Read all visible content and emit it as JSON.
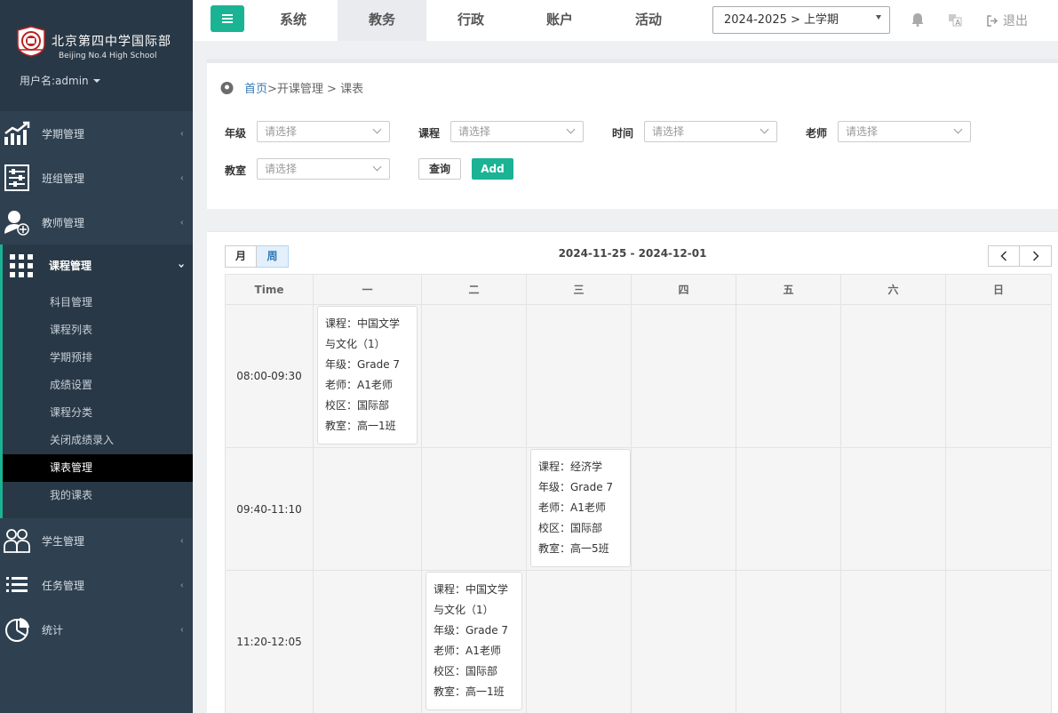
{
  "sidebar": {
    "school_cn": "北京第四中学国际部",
    "school_en": "Beijing No.4 High School",
    "user_label": "用户名:admin",
    "menu": [
      {
        "label": "学期管理",
        "icon": "chart-up-icon"
      },
      {
        "label": "班组管理",
        "icon": "sliders-icon"
      },
      {
        "label": "教师管理",
        "icon": "user-add-icon"
      },
      {
        "label": "课程管理",
        "icon": "grid-icon"
      },
      {
        "label": "学生管理",
        "icon": "users-icon"
      },
      {
        "label": "任务管理",
        "icon": "list-icon"
      },
      {
        "label": "统计",
        "icon": "pie-chart-icon"
      }
    ],
    "submenu": [
      "科目管理",
      "课程列表",
      "学期预排",
      "成绩设置",
      "课程分类",
      "关闭成绩录入",
      "课表管理",
      "我的课表"
    ]
  },
  "topbar": {
    "tabs": [
      "系统",
      "教务",
      "行政",
      "账户",
      "活动"
    ],
    "active_tab": "教务",
    "term": "2024-2025 > 上学期",
    "logout": "退出"
  },
  "breadcrumb": {
    "home": "首页",
    "path": ">开课管理 > 课表"
  },
  "filters": {
    "grade_label": "年级",
    "course_label": "课程",
    "time_label": "时间",
    "teacher_label": "老师",
    "room_label": "教室",
    "placeholder": "请选择",
    "query_button": "查询",
    "add_button": "Add"
  },
  "calendar": {
    "view_month": "月",
    "view_week": "周",
    "range": "2024-11-25 - 2024-12-01",
    "time_header": "Time",
    "days": [
      "一",
      "二",
      "三",
      "四",
      "五",
      "六",
      "日"
    ],
    "slots": [
      "08:00-09:30",
      "09:40-11:10",
      "11:20-12:05"
    ],
    "events": [
      {
        "lines": [
          "课程：中国文学",
          "与文化（1）",
          "年级：Grade 7",
          "老师：A1老师",
          "校区：国际部",
          "教室：高一1班"
        ]
      },
      {
        "lines": [
          "课程：经济学",
          "年级：Grade 7",
          "老师：A1老师",
          "校区：国际部",
          "教室：高一5班"
        ]
      },
      {
        "lines": [
          "课程：中国文学",
          "与文化（1）",
          "年级：Grade 7",
          "老师：A1老师",
          "校区：国际部",
          "教室：高一1班"
        ]
      }
    ]
  },
  "colors": {
    "accent": "#1ab394",
    "sidebar": "#2f4050",
    "link": "#337ab7"
  }
}
